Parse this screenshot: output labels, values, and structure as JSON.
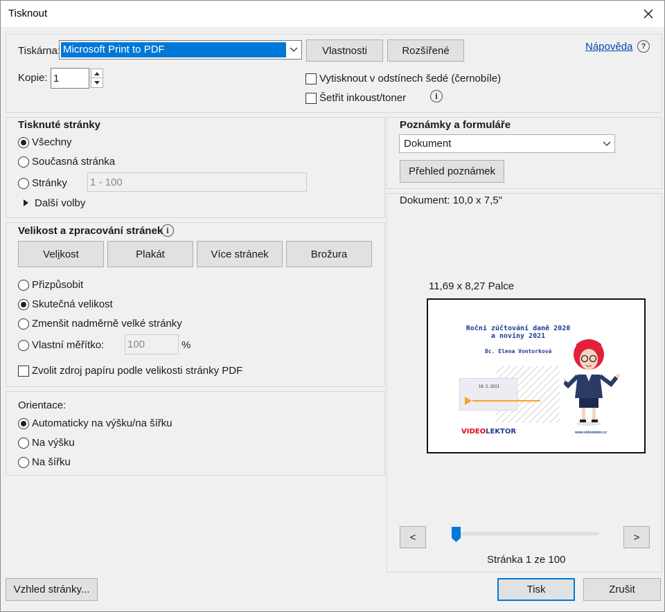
{
  "window": {
    "title": "Tisknout"
  },
  "printer": {
    "label": "Tiskárna:",
    "selected": "Microsoft Print to PDF",
    "properties_btn": "Vlastnosti",
    "advanced_btn": "Rozšířené",
    "help_link": "Nápověda",
    "copies_label": "Kopie:",
    "copies_value": "1",
    "grayscale_label": "Vytisknout v odstínech šedé (černobíle)",
    "save_ink_label": "Šetřit inkoust/toner"
  },
  "pages": {
    "heading": "Tisknuté stránky",
    "all": "Všechny",
    "current": "Současná stránka",
    "pages": "Stránky",
    "range_placeholder": "1 - 100",
    "more": "Další volby",
    "selected": "all"
  },
  "sizing": {
    "heading": "Velikost a zpracování stránek",
    "tabs": [
      "Velikost",
      "Plakát",
      "Více stránek",
      "Brožura"
    ],
    "fit": "Přizpůsobit",
    "actual": "Skutečná velikost",
    "shrink": "Zmenšit nadměrně velké stránky",
    "custom": "Vlastní měřítko:",
    "custom_value": "100",
    "percent": "%",
    "paper_source": "Zvolit zdroj papíru podle velikosti stránky PDF",
    "selected": "actual"
  },
  "orientation": {
    "heading": "Orientace:",
    "auto": "Automaticky na výšku/na šířku",
    "portrait": "Na výšku",
    "landscape": "Na šířku",
    "selected": "auto"
  },
  "comments": {
    "heading": "Poznámky a formuláře",
    "selected": "Dokument",
    "summary_btn": "Přehled poznámek"
  },
  "preview": {
    "doc_size": "Dokument: 10,0 x 7,5\"",
    "paper_size": "11,69 x 8,27 Palce",
    "slide_title": "Roční zúčtování daně 2020 a noviny 2021",
    "slide_author": "Bc. Elena Vontorková",
    "slide_date": "16. 2. 2021",
    "slide_brand_a": "VIDEO",
    "slide_brand_b": "LEKTOR",
    "slide_url": "www.videolektor.cz",
    "page_label": "Stránka 1 ze 100",
    "prev": "<",
    "next": ">",
    "position": 0.01
  },
  "footer": {
    "page_setup": "Vzhled stránky...",
    "print": "Tisk",
    "cancel": "Zrušit"
  },
  "colors": {
    "accent": "#0078d7",
    "selection": "#0078d7",
    "brand_red": "#e2001a",
    "brand_blue": "#1d3c8f",
    "play_orange": "#f5a623"
  }
}
